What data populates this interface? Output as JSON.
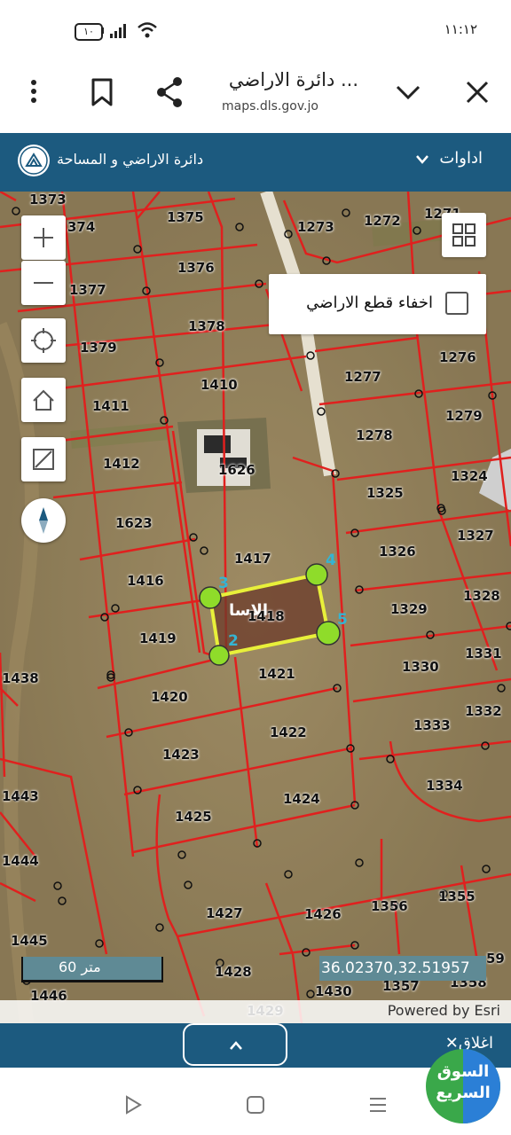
{
  "status_bar": {
    "battery": "١٠",
    "time": "١١:١٢"
  },
  "browser": {
    "title": "دائرة الاراضي ...",
    "url": "maps.dls.gov.jo"
  },
  "app_header": {
    "org_name": "دائرة الاراضي و المساحة",
    "tools_label": "اداوات"
  },
  "map": {
    "hide_parcels_label": "اخفاء قطع الاراضي",
    "hide_parcels_checked": false,
    "scale_label": "60 متر",
    "coordinates": "36.02370,32.51957",
    "attribution": "Powered by Esri",
    "selected_parcel": "1418",
    "selected_parcel_overlay_text": "الاسا",
    "vertex_labels": [
      "2",
      "3",
      "4",
      "5"
    ],
    "parcels": [
      "1373",
      "374",
      "1375",
      "1273",
      "1272",
      "1271",
      "1376",
      "1377",
      "1378",
      "1379",
      "1410",
      "1411",
      "1276",
      "1277",
      "1279",
      "1278",
      "1412",
      "1626",
      "1324",
      "1325",
      "1623",
      "1327",
      "1326",
      "1417",
      "1416",
      "1328",
      "1329",
      "1419",
      "1331",
      "1330",
      "1438",
      "1421",
      "1420",
      "1332",
      "1333",
      "1422",
      "1423",
      "1334",
      "1443",
      "1424",
      "1425",
      "1444",
      "1355",
      "1356",
      "1427",
      "1426",
      "1445",
      "1428",
      "1430",
      "1357",
      "1358",
      "1446",
      "1429",
      "59"
    ],
    "accent_colors": {
      "parcel_lines": "#e0201e",
      "selection": "#e8f03a",
      "vertex": "#8fdc2a"
    }
  },
  "bottom_panel": {
    "close_label": "اغلاق"
  },
  "watermark": {
    "line1": "السوق",
    "line2": "السريع"
  }
}
